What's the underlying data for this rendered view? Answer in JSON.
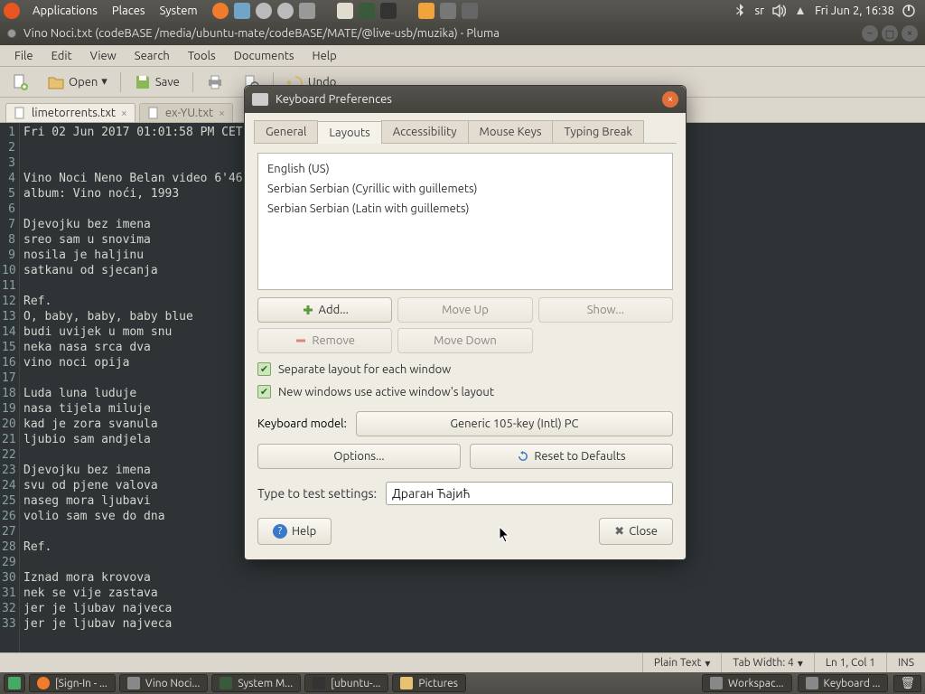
{
  "panel": {
    "menus": {
      "applications": "Applications",
      "places": "Places",
      "system": "System"
    },
    "tray": {
      "lang": "sr",
      "clock": "Fri Jun  2, 16:38"
    }
  },
  "pluma": {
    "title": "Vino Noci.txt (codeBASE /media/ubuntu-mate/codeBASE/MATE/@live-usb/muzika) - Pluma",
    "menus": {
      "file": "File",
      "edit": "Edit",
      "view": "View",
      "search": "Search",
      "tools": "Tools",
      "documents": "Documents",
      "help": "Help"
    },
    "toolbar": {
      "open": "Open",
      "save": "Save",
      "undo": "Undo"
    },
    "tabs": {
      "t1": "limetorrents.txt",
      "t2": "ex-YU.txt"
    },
    "status": {
      "lang": "Plain Text",
      "tab": "Tab Width: 4",
      "pos": "Ln 1, Col 1",
      "ins": "INS"
    },
    "lines": [
      "Fri 02 Jun 2017 01:01:58 PM CET",
      "",
      "",
      "Vino Noci Neno Belan video 6'46''",
      "album: Vino noći, 1993",
      "",
      "Djevojku bez imena",
      "sreo sam u snovima",
      "nosila je haljinu",
      "satkanu od sjecanja",
      "",
      "Ref.",
      "O, baby, baby, baby blue",
      "budi uvijek u mom snu",
      "neka nasa srca dva",
      "vino noci opija",
      "",
      "Luda luna luduje",
      "nasa tijela miluje",
      "kad je zora svanula",
      "ljubio sam andjela",
      "",
      "Djevojku bez imena",
      "svu od pjene valova",
      "naseg mora ljubavi",
      "volio sam sve do dna",
      "",
      "Ref.",
      "",
      "Iznad mora krovova",
      "nek se vije zastava",
      "jer je ljubav najveca",
      "jer je ljubav najveca"
    ]
  },
  "dialog": {
    "title": "Keyboard Preferences",
    "tabs": {
      "general": "General",
      "layouts": "Layouts",
      "accessibility": "Accessibility",
      "mousekeys": "Mouse Keys",
      "typing": "Typing Break"
    },
    "layouts": {
      "items": [
        "English (US)",
        "Serbian Serbian (Cyrillic with guillemets)",
        "Serbian Serbian (Latin with guillemets)"
      ],
      "add": "Add...",
      "moveup": "Move Up",
      "show": "Show...",
      "remove": "Remove",
      "movedown": "Move Down",
      "separate": "Separate layout for each window",
      "newwin": "New windows use active window's layout",
      "model_label": "Keyboard model:",
      "model_value": "Generic 105-key (Intl) PC",
      "options": "Options...",
      "reset": "Reset to Defaults"
    },
    "test_label": "Type to test settings:",
    "test_value": "Драган Ћајић ",
    "help": "Help",
    "close": "Close"
  },
  "taskbar": {
    "t1": "[Sign-In - ...",
    "t2": "Vino Noci...",
    "t3": "System M...",
    "t4": "[ubuntu-...",
    "t5": "Pictures",
    "t6": "Workspac...",
    "t7": "Keyboard ..."
  }
}
